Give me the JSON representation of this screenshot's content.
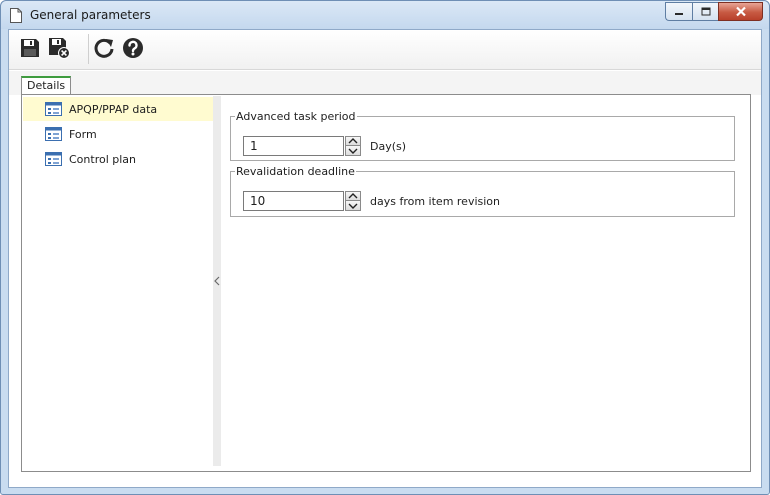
{
  "window": {
    "title": "General parameters",
    "title_icon": "document-icon",
    "controls": [
      "minimize-icon",
      "maximize-icon",
      "close-icon"
    ]
  },
  "toolbar": {
    "buttons": [
      {
        "name": "save",
        "icon": "floppy-disk-icon"
      },
      {
        "name": "save-and-close",
        "icon": "floppy-disk-close-icon"
      },
      {
        "name": "refresh",
        "icon": "refresh-icon"
      },
      {
        "name": "help",
        "icon": "help-icon"
      }
    ]
  },
  "tabs": [
    {
      "label": "Details",
      "active": true
    }
  ],
  "tree": {
    "items": [
      {
        "label": "APQP/PPAP data",
        "icon": "form-list-icon",
        "selected": true
      },
      {
        "label": "Form",
        "icon": "form-list-icon",
        "selected": false
      },
      {
        "label": "Control plan",
        "icon": "form-list-icon",
        "selected": false
      }
    ]
  },
  "groups": {
    "advanced_task": {
      "legend": "Advanced task period",
      "value": "1",
      "unit": "Day(s)"
    },
    "revalidation": {
      "legend": "Revalidation deadline",
      "value": "10",
      "unit": "days from item revision"
    }
  },
  "colors": {
    "tab_accent": "#3f9c3f",
    "selected_row": "#fffbd0",
    "window_frame": "#c9dcf0",
    "close_button": "#c75a43"
  }
}
